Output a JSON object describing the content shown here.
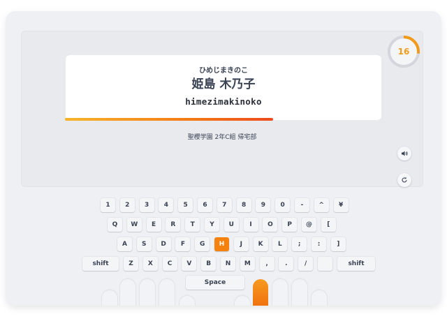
{
  "word_card": {
    "reading": "ひめじまきのこ",
    "word": "姫島 木乃子",
    "romaji": "himezimakinoko",
    "progress": 0.66,
    "subtitle": "聖櫻学園 2年C組 帰宅部"
  },
  "timer": {
    "value": "16",
    "fraction_remaining": 0.27,
    "color": "#f39a1b"
  },
  "controls": {
    "sound_icon": "speaker-icon",
    "retry_icon": "refresh-icon"
  },
  "keyboard": {
    "highlight_key": "H",
    "highlight_color": "#f5820f",
    "row1": [
      "1",
      "2",
      "3",
      "4",
      "5",
      "6",
      "7",
      "8",
      "9",
      "0",
      "-",
      "^",
      "¥"
    ],
    "row2": [
      "Q",
      "W",
      "E",
      "R",
      "T",
      "Y",
      "U",
      "I",
      "O",
      "P",
      "@",
      "["
    ],
    "row3": [
      "A",
      "S",
      "D",
      "F",
      "G",
      "H",
      "J",
      "K",
      "L",
      ";",
      ":",
      "]"
    ],
    "row4_left": "shift",
    "row4": [
      "Z",
      "X",
      "C",
      "V",
      "B",
      "N",
      "M",
      ",",
      ".",
      "/",
      ""
    ],
    "row4_right": "shift",
    "space": "Space"
  }
}
